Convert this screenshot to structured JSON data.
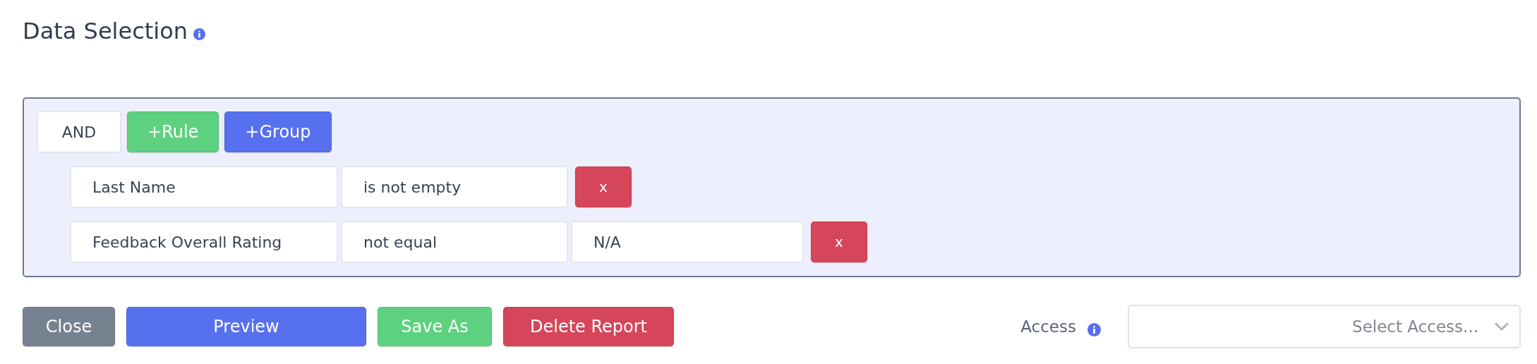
{
  "title": "Data Selection",
  "group": {
    "combinator": "AND",
    "add_rule": "+Rule",
    "add_group": "+Group",
    "rules": [
      {
        "field": "Last Name",
        "operator": "is not empty",
        "remove": "x"
      },
      {
        "field": "Feedback Overall Rating",
        "operator": "not equal",
        "value": "N/A",
        "remove": "x"
      }
    ]
  },
  "buttons": [
    {
      "label": "Close",
      "kind": "secondary"
    },
    {
      "label": "Preview",
      "kind": "primary"
    },
    {
      "label": "Save As",
      "kind": "success"
    },
    {
      "label": "Delete Report",
      "kind": "danger"
    }
  ],
  "access": {
    "label": "Access",
    "placeholder": "Select Access..."
  }
}
